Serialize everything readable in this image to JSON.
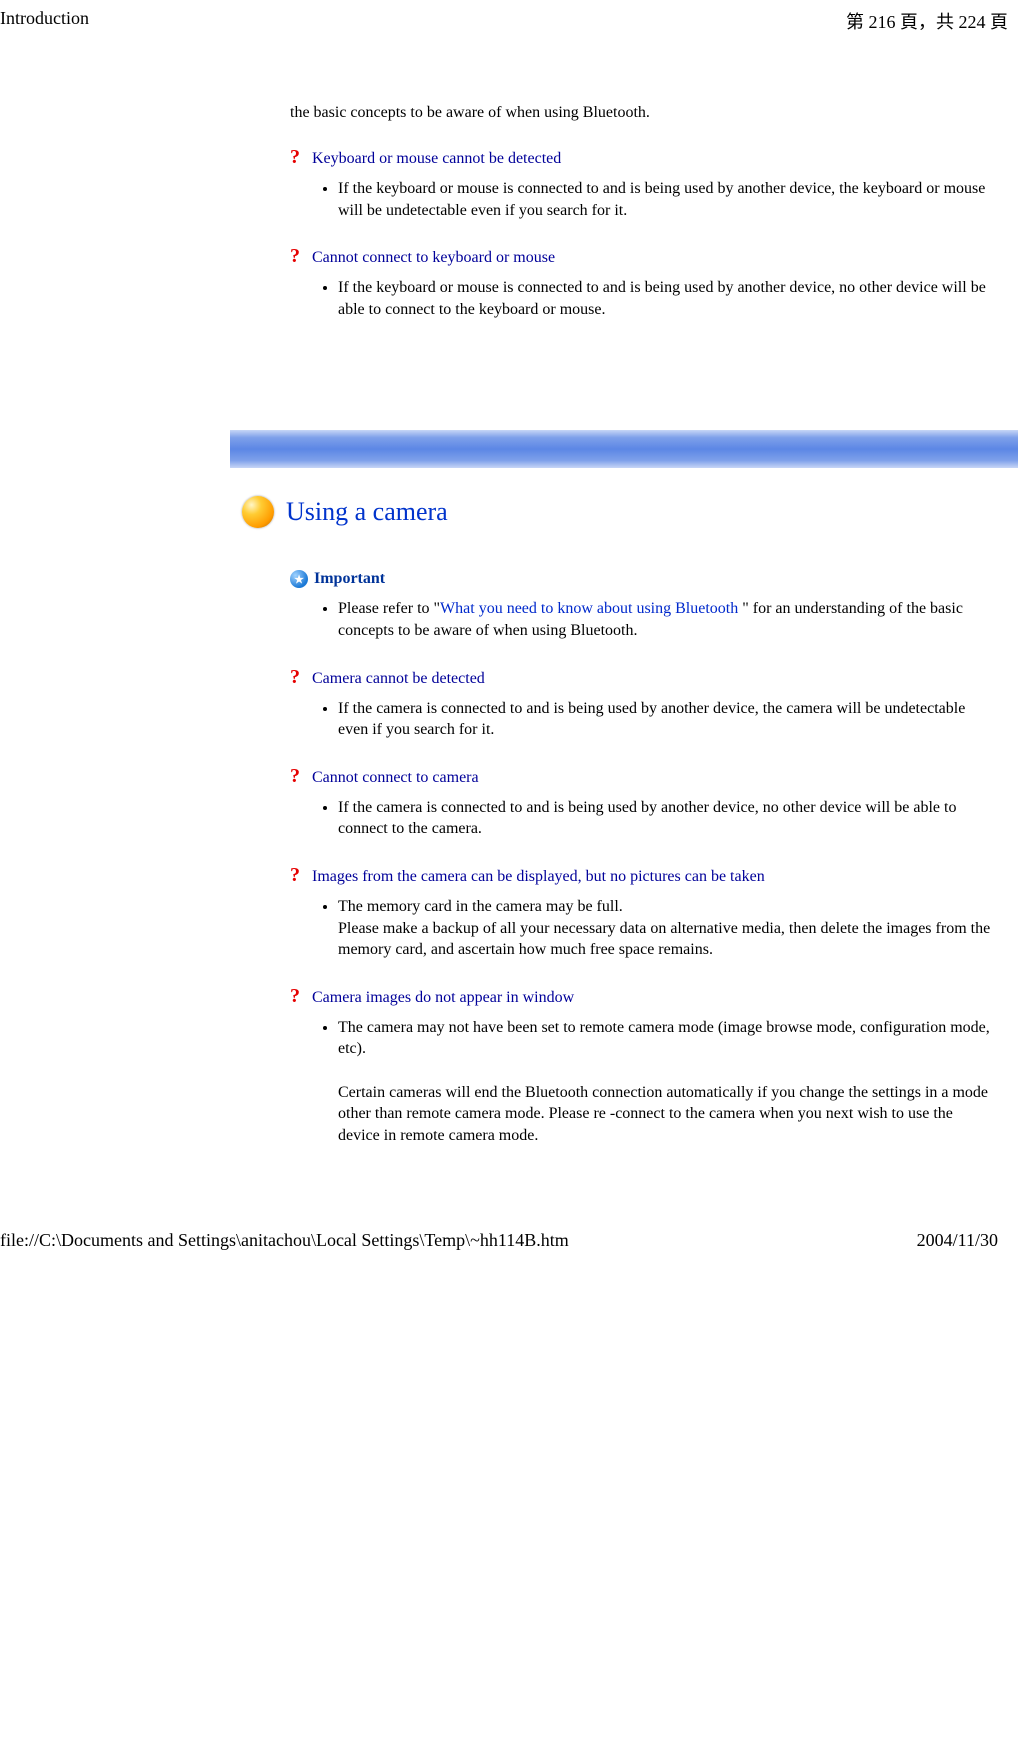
{
  "header": {
    "title": "Introduction",
    "page_label_pre": "第",
    "page_current": "216",
    "page_label_mid": "頁，共",
    "page_total": "224",
    "page_label_post": "頁"
  },
  "top": {
    "intro_line": "the basic concepts to be aware of when using Bluetooth.",
    "faq1_title": "Keyboard or mouse cannot be detected",
    "faq1_item": "If the keyboard or mouse is connected to and is being used by another device, the keyboard or mouse will be undetectable even if you search for it.",
    "faq2_title": "Cannot connect to keyboard or mouse",
    "faq2_item": "If the keyboard or mouse is connected to and is being used by another device, no other device will be able to connect to the keyboard or mouse."
  },
  "section2": {
    "title": "Using a camera",
    "important_label": "Important",
    "important_pre": "Please refer to \"",
    "important_link": "What you need to know about using Bluetooth",
    "important_post": " \" for an understanding of the basic concepts to be aware of when using Bluetooth.",
    "faq1_title": "Camera cannot be detected",
    "faq1_item": "If the camera is connected to and is being used by another device, the camera will be undetectable even if you search for it.",
    "faq2_title": "Cannot connect to camera",
    "faq2_item": "If the camera is connected to and is being used by another device, no other device will be able to connect to the camera.",
    "faq3_title": "Images from the camera can be displayed, but no pictures can be taken",
    "faq3_line1": "The memory card in the camera may be full.",
    "faq3_line2": "Please make a backup of all your necessary data on alternative media, then delete the images from the memory card, and ascertain how much free space remains.",
    "faq4_title": "Camera images do not appear in window",
    "faq4_line1": "The camera may not have been set to remote camera mode (image browse mode, configuration mode, etc).",
    "faq4_line2": "Certain cameras will end the Bluetooth connection automatically if you change the settings in a mode other than remote camera mode. Please re -connect to the camera when you next wish to use the device in remote camera mode."
  },
  "footer": {
    "path": "file://C:\\Documents and Settings\\anitachou\\Local Settings\\Temp\\~hh114B.htm",
    "date": "2004/11/30"
  }
}
